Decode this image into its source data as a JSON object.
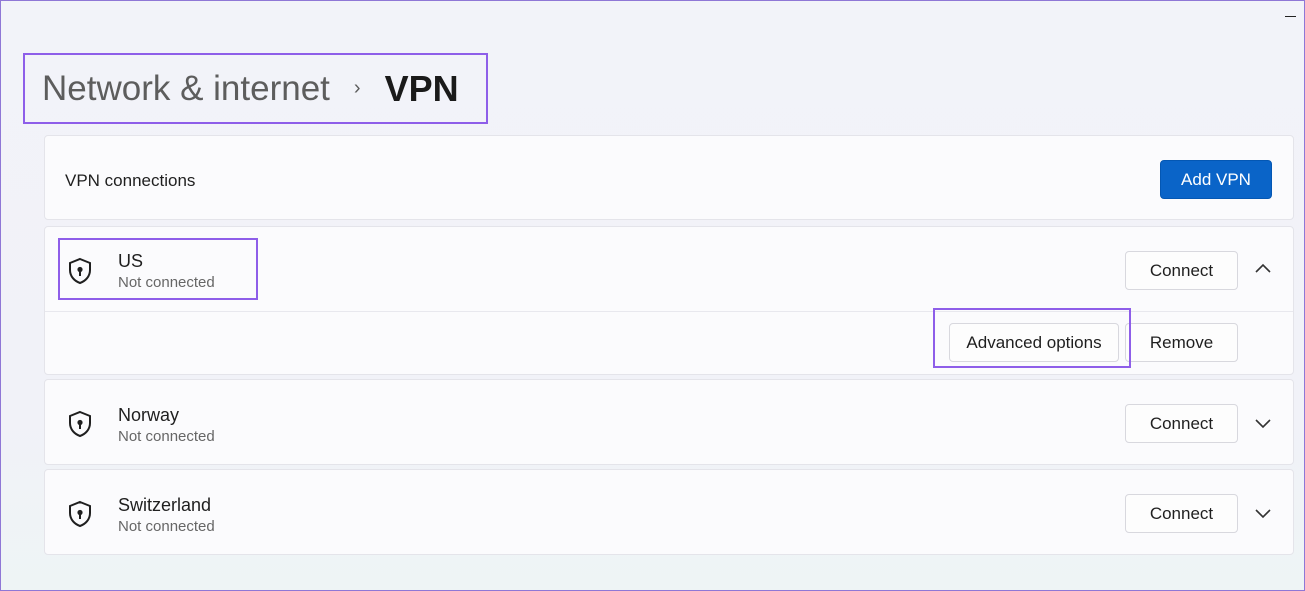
{
  "window": {
    "minimize_glyph": "–"
  },
  "breadcrumb": {
    "parent": "Network & internet",
    "separator": "›",
    "current": "VPN"
  },
  "header_card": {
    "title": "VPN connections",
    "add_button": "Add VPN"
  },
  "connections": [
    {
      "name": "US",
      "status": "Not connected",
      "connect_label": "Connect",
      "expanded": true,
      "chevron": "chevron-up-icon"
    },
    {
      "name": "Norway",
      "status": "Not connected",
      "connect_label": "Connect",
      "expanded": false,
      "chevron": "chevron-down-icon"
    },
    {
      "name": "Switzerland",
      "status": "Not connected",
      "connect_label": "Connect",
      "expanded": false,
      "chevron": "chevron-down-icon"
    }
  ],
  "expanded_actions": {
    "advanced_label": "Advanced options",
    "remove_label": "Remove"
  },
  "colors": {
    "accent": "#0a64c8",
    "highlight": "#8e5ee9"
  },
  "icons": {
    "vpn_icon": "shield-lock-icon"
  }
}
